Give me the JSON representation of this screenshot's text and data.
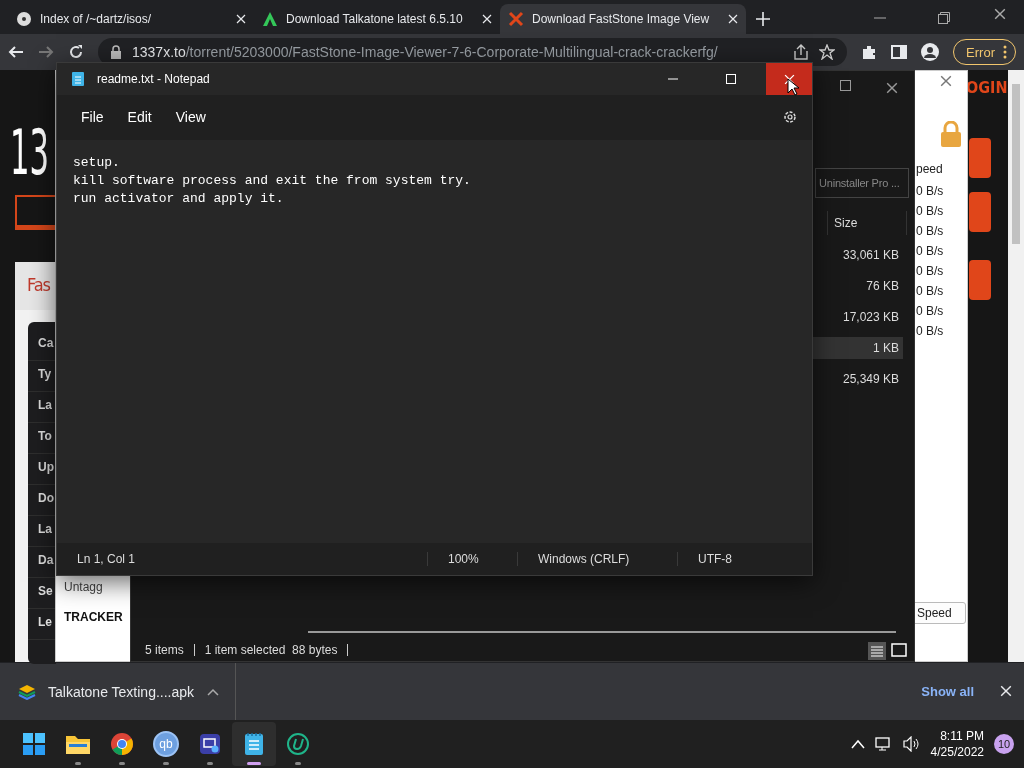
{
  "browser": {
    "tabs": [
      {
        "title": "Index of /~dartz/isos/",
        "kind": "disc",
        "selected": false
      },
      {
        "title": "Download Talkatone latest 6.5.10",
        "kind": "android",
        "selected": false
      },
      {
        "title": "Download FastStone Image View",
        "kind": "cross",
        "selected": true
      }
    ],
    "address": {
      "host": "1337x.to",
      "path": "/torrent/5203000/FastStone-Image-Viewer-7-6-Corporate-Multilingual-crack-crackerfg/"
    },
    "error_button": "Error"
  },
  "website": {
    "logo": "13",
    "login": "OGIN",
    "section_title": "Fas",
    "detail_labels": [
      "Ca",
      "Ty",
      "La",
      "To",
      "Up",
      "Do",
      "La",
      "Da",
      "Se",
      "Le"
    ]
  },
  "torrent_client": {
    "speed_header": "peed",
    "speeds": [
      "0 B/s",
      "0 B/s",
      "0 B/s",
      "0 B/s",
      "0 B/s",
      "0 B/s",
      "0 B/s",
      "0 B/s"
    ],
    "speed_button": "Speed",
    "sidebar": [
      {
        "label": "Untagg",
        "kind": "tag"
      },
      {
        "label": "TRACKER",
        "kind": "heading"
      }
    ]
  },
  "explorer": {
    "search": "Uninstaller Pro ...",
    "size_column": "Size",
    "rows": [
      {
        "size": "33,061 KB",
        "selected": false
      },
      {
        "size": "76 KB",
        "selected": false
      },
      {
        "size": "17,023 KB",
        "selected": false
      },
      {
        "size": "1 KB",
        "selected": true
      },
      {
        "size": "25,349 KB",
        "selected": false
      }
    ],
    "status": [
      "5 items",
      "1 item selected  88 bytes"
    ]
  },
  "notepad": {
    "title": "readme.txt - Notepad",
    "menu": [
      "File",
      "Edit",
      "View"
    ],
    "lines": [
      "setup.",
      "kill software process and exit the from system try.",
      "run activator and apply it."
    ],
    "status": [
      "Ln 1, Col 1",
      "100%",
      "Windows (CRLF)",
      "UTF-8"
    ]
  },
  "downloads": {
    "file": "Talkatone Texting....apk",
    "show_all": "Show all"
  },
  "taskbar": {
    "apps": [
      {
        "kind": "start",
        "active": false
      },
      {
        "kind": "folder",
        "active": false
      },
      {
        "kind": "chrome",
        "active": false
      },
      {
        "kind": "qbittorrent",
        "label": "qb",
        "active": false
      },
      {
        "kind": "remote",
        "active": false
      },
      {
        "kind": "notepad",
        "active": true
      },
      {
        "kind": "uninstaller",
        "active": false
      }
    ],
    "time": "8:11 PM",
    "date": "4/25/2022",
    "notifications": "10"
  }
}
